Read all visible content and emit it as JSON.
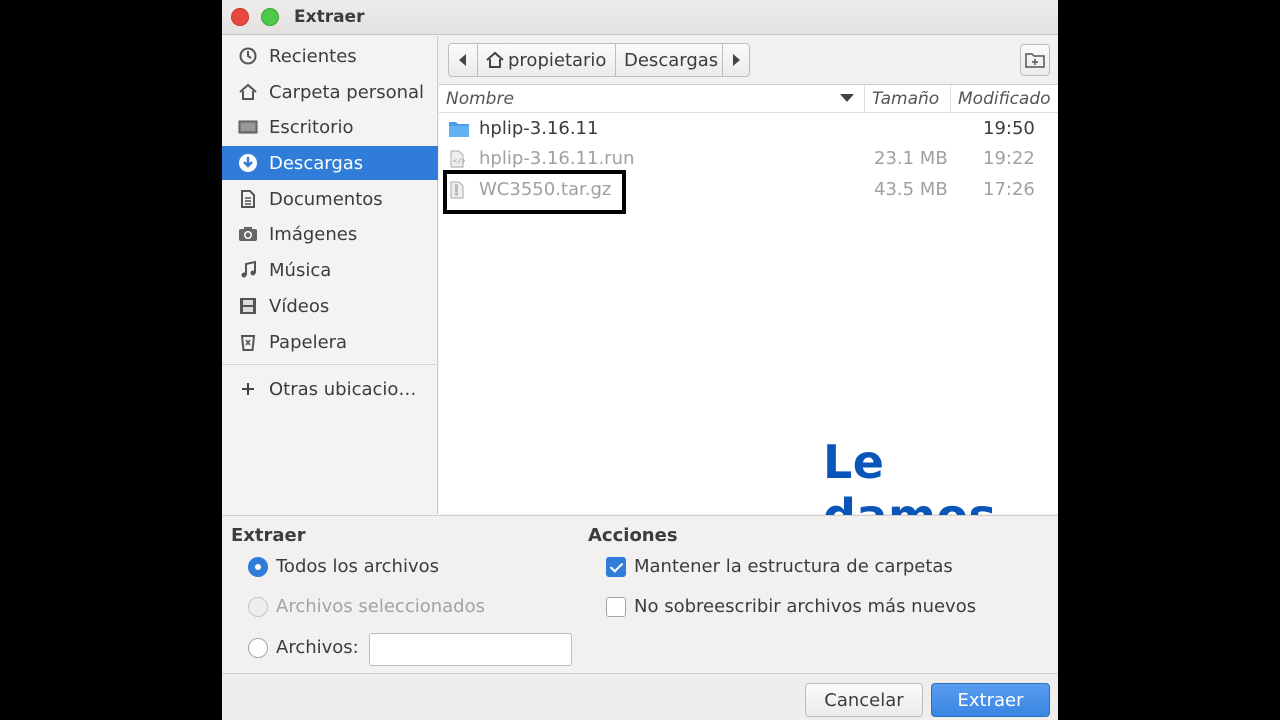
{
  "window": {
    "title": "Extraer"
  },
  "sidebar": {
    "items": [
      {
        "label": "Recientes",
        "icon": "clock-icon"
      },
      {
        "label": "Carpeta personal",
        "icon": "home-icon"
      },
      {
        "label": "Escritorio",
        "icon": "desktop-icon"
      },
      {
        "label": "Descargas",
        "icon": "download-icon",
        "active": true
      },
      {
        "label": "Documentos",
        "icon": "document-icon"
      },
      {
        "label": "Imágenes",
        "icon": "camera-icon"
      },
      {
        "label": "Música",
        "icon": "music-icon"
      },
      {
        "label": "Vídeos",
        "icon": "film-icon"
      },
      {
        "label": "Papelera",
        "icon": "trash-icon"
      }
    ],
    "other_locations": "Otras ubicacio…"
  },
  "pathbar": {
    "segments": [
      "propietario",
      "Descargas"
    ]
  },
  "columns": {
    "name": "Nombre",
    "size": "Tamaño",
    "modified": "Modificado"
  },
  "files": [
    {
      "name": "hplip-3.16.11",
      "size": "",
      "modified": "19:50",
      "type": "folder"
    },
    {
      "name": "hplip-3.16.11.run",
      "size": "23.1 MB",
      "modified": "19:22",
      "type": "script"
    },
    {
      "name": "WC3550.tar.gz",
      "size": "43.5 MB",
      "modified": "17:26",
      "type": "archive"
    }
  ],
  "overlay_caption": "Le damos extraer",
  "extract_section": {
    "heading": "Extraer",
    "all_files": "Todos los archivos",
    "selected_files": "Archivos seleccionados",
    "files_label": "Archivos:",
    "files_value": ""
  },
  "actions_section": {
    "heading": "Acciones",
    "keep_structure": "Mantener la estructura de carpetas",
    "no_overwrite": "No sobreescribir archivos más nuevos"
  },
  "buttons": {
    "cancel": "Cancelar",
    "extract": "Extraer"
  },
  "colors": {
    "accent": "#2f7dd8",
    "caption": "#0a56b8"
  }
}
